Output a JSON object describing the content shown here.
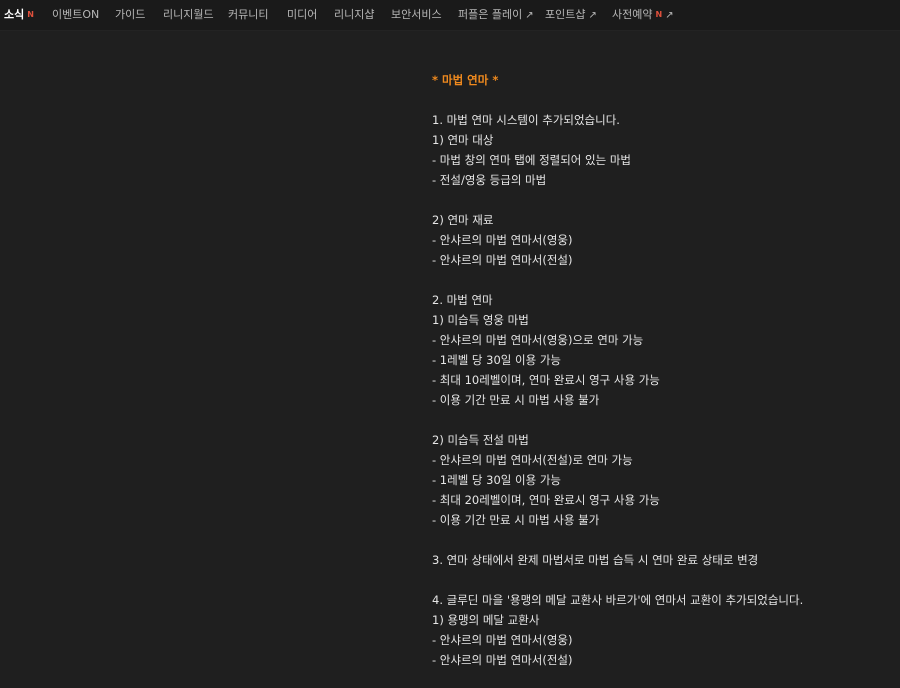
{
  "nav": {
    "items": [
      {
        "label": "소식",
        "badge": "N",
        "external": false,
        "active": true
      },
      {
        "label": "이벤트ON",
        "badge": "",
        "external": false,
        "active": false
      },
      {
        "label": "가이드",
        "badge": "",
        "external": false,
        "active": false
      },
      {
        "label": "리니지월드",
        "badge": "",
        "external": false,
        "active": false
      },
      {
        "label": "커뮤니티",
        "badge": "",
        "external": false,
        "active": false
      },
      {
        "label": "미디어",
        "badge": "",
        "external": false,
        "active": false
      },
      {
        "label": "리니지샵",
        "badge": "",
        "external": false,
        "active": false
      },
      {
        "label": "보안서비스",
        "badge": "",
        "external": false,
        "active": false
      },
      {
        "label": "퍼플은 플레이",
        "badge": "",
        "external": true,
        "active": false
      },
      {
        "label": "포인트샵",
        "badge": "",
        "external": true,
        "active": false
      },
      {
        "label": "사전예약",
        "badge": "N",
        "external": true,
        "active": false
      }
    ],
    "external_icon": "↗",
    "colors": {
      "badge": "#e0503c",
      "active": "#ffffff",
      "inactive": "#b7b7b7"
    }
  },
  "article": {
    "title_color": "#f08a1e",
    "lines": [
      {
        "text": "* 마법 연마 *",
        "type": "title"
      },
      {
        "text": "",
        "type": "blank"
      },
      {
        "text": "1. 마법 연마 시스템이 추가되었습니다.",
        "type": "text"
      },
      {
        "text": "1) 연마 대상",
        "type": "text"
      },
      {
        "text": "- 마법 창의 연마 탭에 정렬되어 있는 마법",
        "type": "text"
      },
      {
        "text": "- 전설/영웅 등급의 마법",
        "type": "text"
      },
      {
        "text": "",
        "type": "blank"
      },
      {
        "text": "2) 연마 재료",
        "type": "text"
      },
      {
        "text": "- 안샤르의 마법 연마서(영웅)",
        "type": "text"
      },
      {
        "text": "- 안샤르의 마법 연마서(전설)",
        "type": "text"
      },
      {
        "text": "",
        "type": "blank"
      },
      {
        "text": "2. 마법 연마",
        "type": "text"
      },
      {
        "text": "1) 미습득 영웅 마법",
        "type": "text"
      },
      {
        "text": "- 안샤르의 마법 연마서(영웅)으로 연마 가능",
        "type": "text"
      },
      {
        "text": "- 1레벨 당 30일 이용 가능",
        "type": "text"
      },
      {
        "text": "- 최대 10레벨이며, 연마 완료시 영구 사용 가능",
        "type": "text"
      },
      {
        "text": "- 이용 기간 만료 시 마법 사용 불가",
        "type": "text"
      },
      {
        "text": "",
        "type": "blank"
      },
      {
        "text": "2) 미습득 전설 마법",
        "type": "text"
      },
      {
        "text": "- 안샤르의 마법 연마서(전설)로 연마 가능",
        "type": "text"
      },
      {
        "text": "- 1레벨 당 30일 이용 가능",
        "type": "text"
      },
      {
        "text": "- 최대 20레벨이며, 연마 완료시 영구 사용 가능",
        "type": "text"
      },
      {
        "text": "- 이용 기간 만료 시 마법 사용 불가",
        "type": "text"
      },
      {
        "text": "",
        "type": "blank"
      },
      {
        "text": "3. 연마 상태에서 완제 마법서로 마법 습득 시 연마 완료 상태로 변경",
        "type": "text"
      },
      {
        "text": "",
        "type": "blank"
      },
      {
        "text": "4. 글루딘 마을 '용맹의 메달 교환사 바르가'에 연마서 교환이 추가되었습니다.",
        "type": "text"
      },
      {
        "text": "1) 용맹의 메달 교환사",
        "type": "text"
      },
      {
        "text": "- 안샤르의 마법 연마서(영웅)",
        "type": "text"
      },
      {
        "text": "- 안샤르의 마법 연마서(전설)",
        "type": "text"
      }
    ]
  }
}
